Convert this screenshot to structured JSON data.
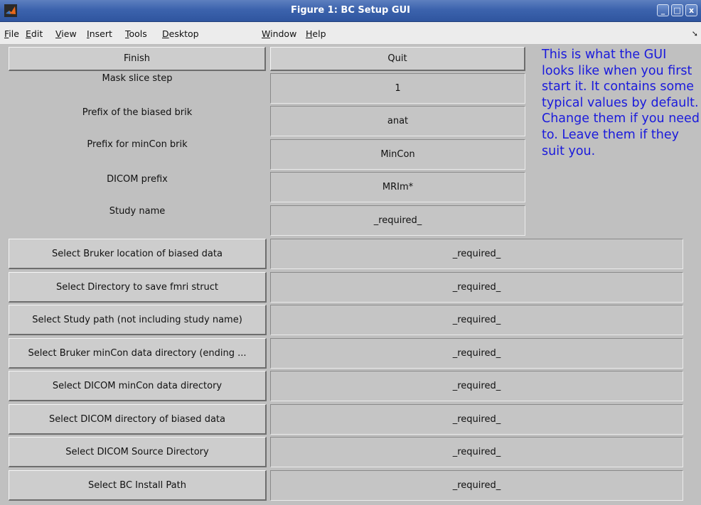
{
  "window": {
    "title": "Figure 1: BC Setup GUI",
    "controls": {
      "minimize": "_",
      "maximize": "□",
      "close": "x"
    }
  },
  "menu": {
    "items": [
      {
        "prefix": "",
        "mnemonic": "F",
        "rest": "ile"
      },
      {
        "prefix": "",
        "mnemonic": "E",
        "rest": "dit"
      },
      {
        "prefix": "",
        "mnemonic": "V",
        "rest": "iew"
      },
      {
        "prefix": "",
        "mnemonic": "I",
        "rest": "nsert"
      },
      {
        "prefix": "",
        "mnemonic": "T",
        "rest": "ools"
      },
      {
        "prefix": "",
        "mnemonic": "D",
        "rest": "esktop"
      },
      {
        "prefix": "",
        "mnemonic": "W",
        "rest": "indow"
      },
      {
        "prefix": "",
        "mnemonic": "H",
        "rest": "elp"
      }
    ],
    "overflow_icon": "arrow-icon"
  },
  "top_buttons": {
    "finish": "Finish",
    "quit": "Quit"
  },
  "fields": [
    {
      "label": "Mask slice step",
      "value": "1"
    },
    {
      "label": "Prefix of the biased brik",
      "value": "anat"
    },
    {
      "label": "Prefix for minCon brik",
      "value": "MinCon"
    },
    {
      "label": "DICOM prefix",
      "value": "MRIm*"
    },
    {
      "label": "Study name",
      "value": "_required_"
    }
  ],
  "note": "This is what the GUI looks like when you first start it. It contains some typical values by default. Change them if you need to. Leave them if they suit you.",
  "selectors": [
    {
      "button": "Select Bruker location of biased data",
      "value": "_required_"
    },
    {
      "button": "Select Directory to save fmri struct",
      "value": "_required_"
    },
    {
      "button": "Select Study path (not including study name)",
      "value": "_required_"
    },
    {
      "button": "Select Bruker minCon data directory (ending ...",
      "value": "_required_"
    },
    {
      "button": "Select DICOM minCon data directory",
      "value": "_required_"
    },
    {
      "button": "Select DICOM directory of biased data",
      "value": "_required_"
    },
    {
      "button": "Select DICOM Source Directory",
      "value": "_required_"
    },
    {
      "button": "Select BC Install Path",
      "value": "_required_"
    }
  ]
}
